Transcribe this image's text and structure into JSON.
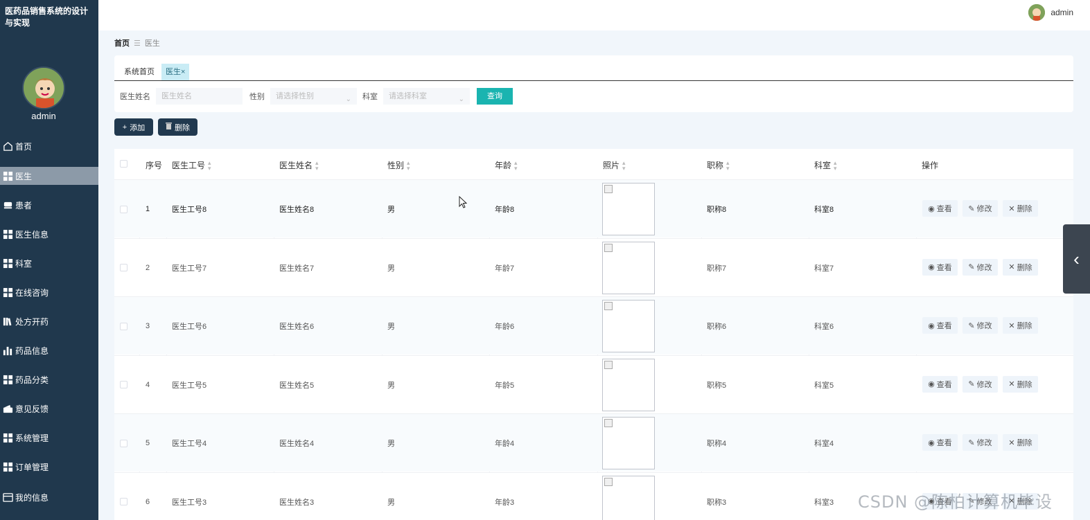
{
  "app": {
    "title": "医药品销售系统的设计与实现"
  },
  "user": {
    "name": "admin"
  },
  "sidebar": {
    "items": [
      {
        "label": "首页",
        "icon": "home-icon"
      },
      {
        "label": "医生",
        "icon": "grid-icon",
        "active": true
      },
      {
        "label": "患者",
        "icon": "bed-icon"
      },
      {
        "label": "医生信息",
        "icon": "grid-icon"
      },
      {
        "label": "科室",
        "icon": "grid-icon"
      },
      {
        "label": "在线咨询",
        "icon": "grid-icon"
      },
      {
        "label": "处方开药",
        "icon": "book-icon"
      },
      {
        "label": "药品信息",
        "icon": "bar-chart-icon"
      },
      {
        "label": "药品分类",
        "icon": "grid-icon"
      },
      {
        "label": "意见反馈",
        "icon": "wallet-icon"
      },
      {
        "label": "系统管理",
        "icon": "grid-icon"
      },
      {
        "label": "订单管理",
        "icon": "grid-icon"
      },
      {
        "label": "我的信息",
        "icon": "id-card-icon"
      }
    ]
  },
  "breadcrumb": {
    "home": "首页",
    "separator": "☰",
    "current": "医生"
  },
  "tabs": [
    {
      "label": "系统首页"
    },
    {
      "label": "医生",
      "close": "×"
    }
  ],
  "search": {
    "name_label": "医生姓名",
    "name_placeholder": "医生姓名",
    "gender_label": "性别",
    "gender_placeholder": "请选择性别",
    "dept_label": "科室",
    "dept_placeholder": "请选择科室",
    "query_button": "查询"
  },
  "actions": {
    "add": "添加",
    "delete": "删除"
  },
  "table": {
    "headers": [
      "序号",
      "医生工号",
      "医生姓名",
      "性别",
      "年龄",
      "照片",
      "职称",
      "科室",
      "操作"
    ],
    "rows": [
      {
        "idx": "1",
        "id": "医生工号8",
        "name": "医生姓名8",
        "gender": "男",
        "age": "年龄8",
        "title": "职称8",
        "dept": "科室8"
      },
      {
        "idx": "2",
        "id": "医生工号7",
        "name": "医生姓名7",
        "gender": "男",
        "age": "年龄7",
        "title": "职称7",
        "dept": "科室7"
      },
      {
        "idx": "3",
        "id": "医生工号6",
        "name": "医生姓名6",
        "gender": "男",
        "age": "年龄6",
        "title": "职称6",
        "dept": "科室6"
      },
      {
        "idx": "4",
        "id": "医生工号5",
        "name": "医生姓名5",
        "gender": "男",
        "age": "年龄5",
        "title": "职称5",
        "dept": "科室5"
      },
      {
        "idx": "5",
        "id": "医生工号4",
        "name": "医生姓名4",
        "gender": "男",
        "age": "年龄4",
        "title": "职称4",
        "dept": "科室4"
      },
      {
        "idx": "6",
        "id": "医生工号3",
        "name": "医生姓名3",
        "gender": "男",
        "age": "年龄3",
        "title": "职称3",
        "dept": "科室3"
      }
    ],
    "ops": {
      "view": "查看",
      "edit": "修改",
      "delete": "删除"
    }
  },
  "watermark": "CSDN @陈柏计算机毕设",
  "colors": {
    "sidebar": "#20384d",
    "accent": "#1ab4b0",
    "active_menu": "#8c9aa8"
  }
}
